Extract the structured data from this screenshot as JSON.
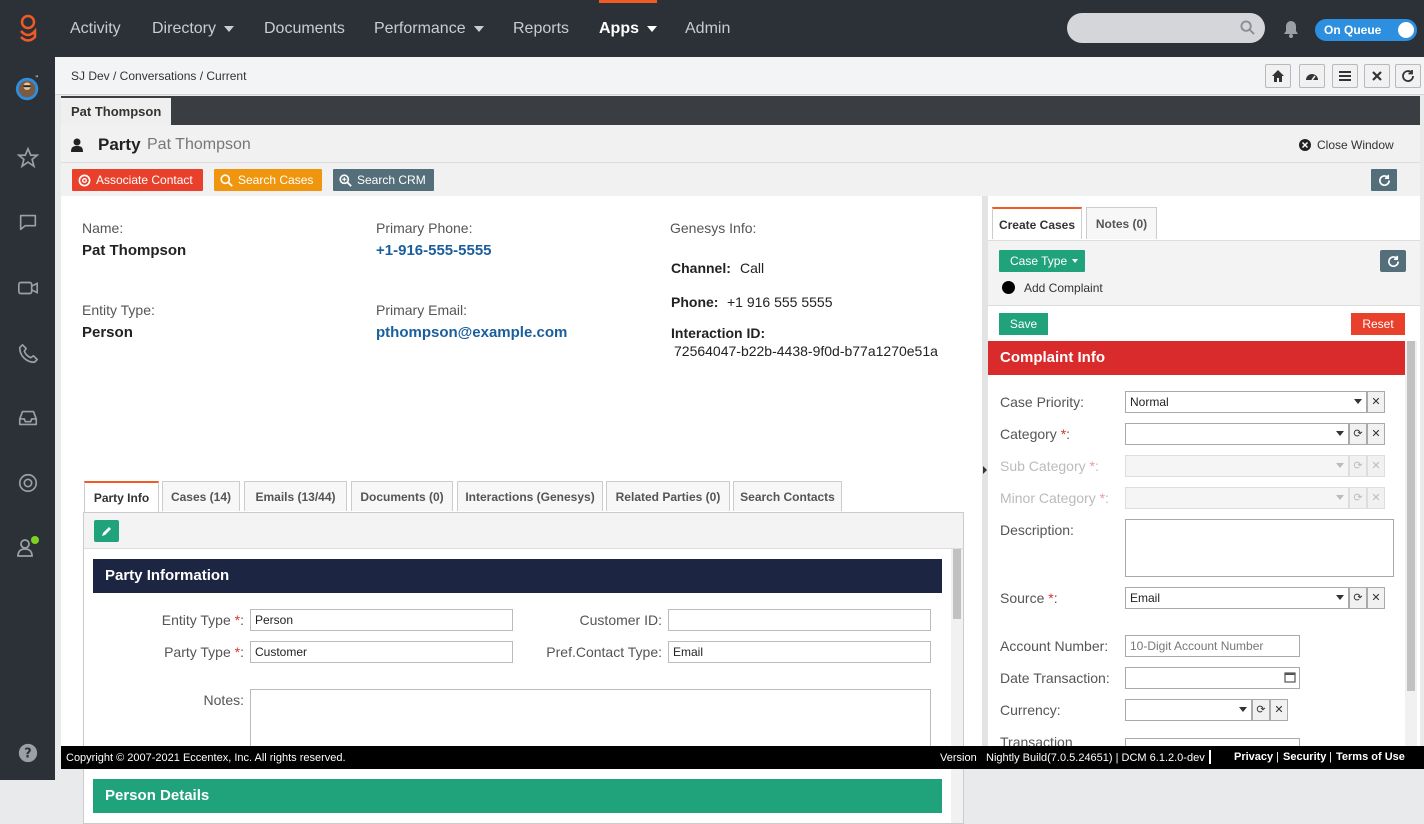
{
  "nav": {
    "items": [
      {
        "label": "Activity"
      },
      {
        "label": "Directory"
      },
      {
        "label": "Documents"
      },
      {
        "label": "Performance"
      },
      {
        "label": "Reports"
      },
      {
        "label": "Apps"
      },
      {
        "label": "Admin"
      }
    ],
    "active": "Apps",
    "queue_status": "On Queue"
  },
  "breadcrumb": "SJ Dev / Conversations / Current",
  "person_tab": "Pat Thompson",
  "party": {
    "title": "Party",
    "name": "Pat Thompson",
    "close_label": "Close Window"
  },
  "actions": {
    "associate": "Associate Contact",
    "search_cases": "Search Cases",
    "search_crm": "Search CRM"
  },
  "details": {
    "name_label": "Name:",
    "name": "Pat Thompson",
    "entity_type_label": "Entity Type:",
    "entity_type": "Person",
    "phone_label": "Primary Phone:",
    "phone": "+1-916-555-5555",
    "email_label": "Primary Email:",
    "email": "pthompson@example.com",
    "genesys_label": "Genesys Info:",
    "channel_label": "Channel:",
    "channel": "Call",
    "gphone_label": "Phone:",
    "gphone": "+1 916 555 5555",
    "interaction_label": "Interaction ID:",
    "interaction_id": "72564047-b22b-4438-9f0d-b77a1270e51a"
  },
  "subtabs": [
    {
      "label": "Party Info"
    },
    {
      "label": "Cases (14)"
    },
    {
      "label": "Emails (13/44)"
    },
    {
      "label": "Documents (0)"
    },
    {
      "label": "Interactions (Genesys)"
    },
    {
      "label": "Related Parties (0)"
    },
    {
      "label": "Search Contacts"
    }
  ],
  "party_info": {
    "section_title": "Party Information",
    "entity_type_label": "Entity Type",
    "entity_type": "Person",
    "party_type_label": "Party Type",
    "party_type": "Customer",
    "customer_id_label": "Customer ID:",
    "customer_id": "",
    "pref_contact_label": "Pref.Contact Type:",
    "pref_contact": "Email",
    "notes_label": "Notes:",
    "person_section": "Person Details"
  },
  "right": {
    "tabs": [
      {
        "label": "Create Cases"
      },
      {
        "label": "Notes (0)"
      }
    ],
    "case_type": "Case Type",
    "add_complaint": "Add Complaint",
    "save": "Save",
    "reset": "Reset",
    "section": "Complaint Info",
    "fields": {
      "priority_label": "Case Priority:",
      "priority": "Normal",
      "category_label": "Category",
      "subcategory_label": "Sub Category",
      "minor_label": "Minor Category",
      "description_label": "Description:",
      "source_label": "Source",
      "source": "Email",
      "account_label": "Account Number:",
      "account_placeholder": "10-Digit Account Number",
      "date_label": "Date Transaction:",
      "currency_label": "Currency:",
      "transaction_label": "Transaction"
    }
  },
  "footer": {
    "copyright": "Copyright © 2007-2021 Eccentex, Inc. All rights reserved.",
    "version_label": "Version",
    "version": "Nightly Build(7.0.5.24651) | DCM 6.1.2.0-dev",
    "privacy": "Privacy",
    "security": "Security",
    "terms": "Terms of Use"
  },
  "colors": {
    "accent": "#f15a24",
    "navy": "#1c2541",
    "green": "#20a27a",
    "red": "#d9342b",
    "orange": "#f0960e",
    "slate": "#546e7a",
    "link": "#1b5e9d"
  }
}
